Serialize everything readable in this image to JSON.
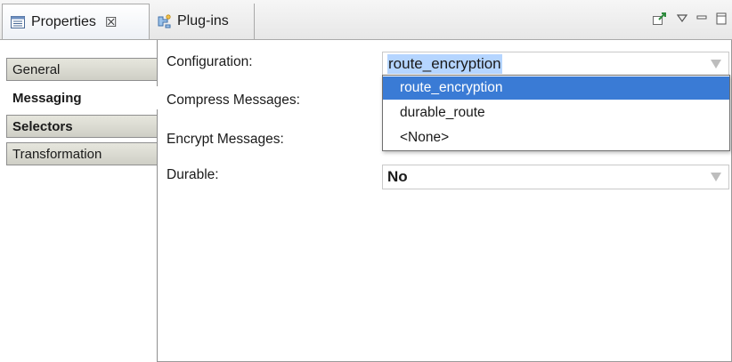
{
  "tabs": [
    {
      "label": "Properties",
      "icon": "properties-icon",
      "active": true,
      "close": "☒"
    },
    {
      "label": "Plug-ins",
      "icon": "plugins-icon",
      "active": false
    }
  ],
  "view_tools": [
    "pin-icon",
    "view-menu-icon",
    "minimize-icon",
    "maximize-icon"
  ],
  "categories": [
    {
      "label": "General",
      "active": false
    },
    {
      "label": "Messaging",
      "active": true
    },
    {
      "label": "Selectors",
      "active": false
    },
    {
      "label": "Transformation",
      "active": false
    }
  ],
  "form": {
    "configuration_label": "Configuration:",
    "configuration_value": "route_encryption",
    "compress_label": "Compress Messages:",
    "encrypt_label": "Encrypt Messages:",
    "durable_label": "Durable:",
    "durable_value": "No",
    "dropdown_options": [
      "route_encryption",
      "durable_route",
      "<None>"
    ],
    "dropdown_selected": "route_encryption"
  },
  "colors": {
    "selection_highlight": "#3a7bd5",
    "text_selection": "#b5d5ff",
    "tab_background": "#e7e7e7"
  }
}
